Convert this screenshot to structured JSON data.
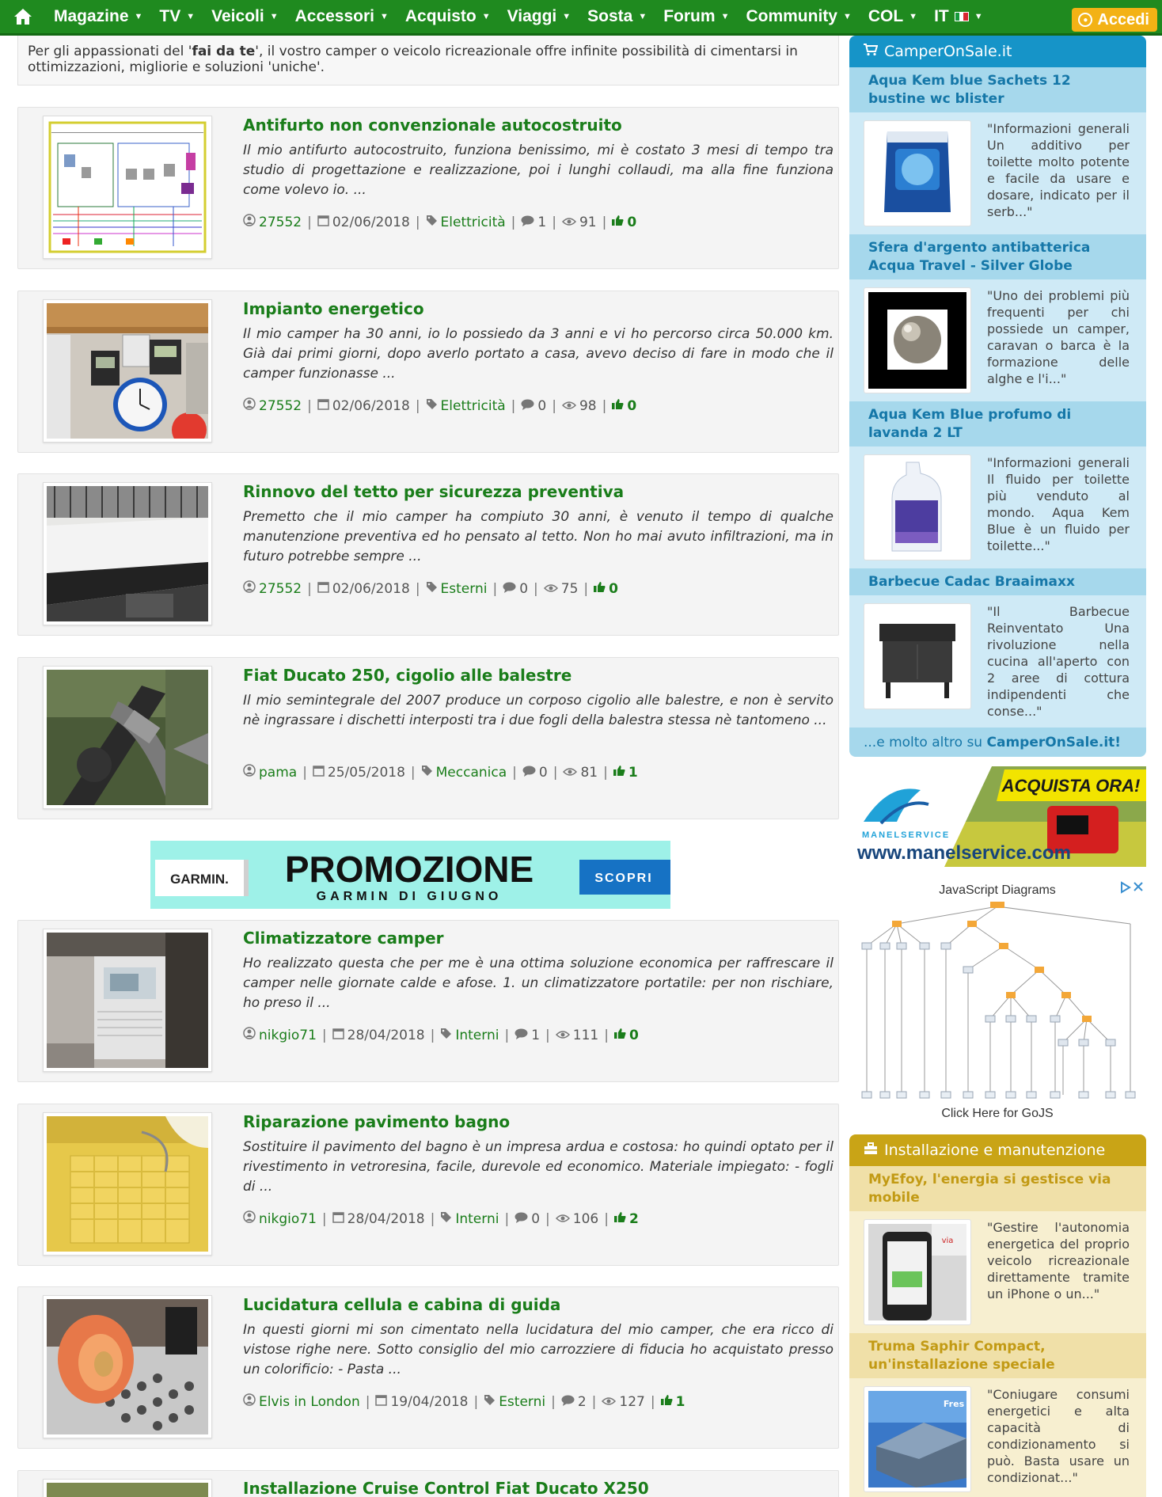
{
  "nav": {
    "items": [
      "Magazine",
      "TV",
      "Veicoli",
      "Accessori",
      "Acquisto",
      "Viaggi",
      "Sosta",
      "Forum",
      "Community",
      "COL",
      "IT"
    ],
    "login": "Accedi"
  },
  "intro": {
    "before": "Per gli appassionati del '",
    "bold": "fai da te",
    "after": "', il vostro camper o veicolo ricreazionale offre infinite possibilità di cimentarsi in ottimizzazioni, migliorie e soluzioni 'uniche'."
  },
  "articles": [
    {
      "title": "Antifurto non convenzionale autocostruito",
      "excerpt": "Il mio antifurto autocostruito, funziona benissimo, mi è costato 3 mesi di tempo tra studio di progettazione e realizzazione, poi i lunghi collaudi, ma alla fine funziona come volevo io. ...",
      "author": "27552",
      "date": "02/06/2018",
      "category": "Elettricità",
      "comments": "1",
      "views": "91",
      "likes": "0"
    },
    {
      "title": "Impianto energetico",
      "excerpt": "Il mio camper ha 30 anni, io lo possiedo da 3 anni e vi ho percorso circa 50.000 km. Già dai primi giorni, dopo averlo portato a casa, avevo deciso di fare in modo che il camper funzionasse ...",
      "author": "27552",
      "date": "02/06/2018",
      "category": "Elettricità",
      "comments": "0",
      "views": "98",
      "likes": "0"
    },
    {
      "title": "Rinnovo del tetto per sicurezza preventiva",
      "excerpt": "Premetto che il mio camper ha compiuto 30 anni, è venuto il tempo di qualche manutenzione preventiva ed ho pensato al tetto. Non ho mai avuto infiltrazioni, ma in futuro potrebbe sempre ...",
      "author": "27552",
      "date": "02/06/2018",
      "category": "Esterni",
      "comments": "0",
      "views": "75",
      "likes": "0"
    },
    {
      "title": "Fiat Ducato 250, cigolio alle balestre",
      "excerpt": "Il mio semintegrale del 2007 produce un corposo cigolio alle balestre, e non è servito nè ingrassare i dischetti interposti tra i due fogli della balestra stessa nè tantomeno ...",
      "author": "pama",
      "date": "25/05/2018",
      "category": "Meccanica",
      "comments": "0",
      "views": "81",
      "likes": "1"
    },
    {
      "title": "Climatizzatore camper",
      "excerpt": "Ho realizzato questa che per me è una ottima soluzione economica per raffrescare il camper nelle giornate calde e afose. 1. un climatizzatore portatile: per non rischiare, ho preso il ...",
      "author": "nikgio71",
      "date": "28/04/2018",
      "category": "Interni",
      "comments": "1",
      "views": "111",
      "likes": "0"
    },
    {
      "title": "Riparazione pavimento bagno",
      "excerpt": "Sostituire il pavimento del bagno è un impresa ardua e costosa: ho quindi optato per il rivestimento in vetroresina, facile, durevole ed economico. Materiale impiegato: - fogli di ...",
      "author": "nikgio71",
      "date": "28/04/2018",
      "category": "Interni",
      "comments": "0",
      "views": "106",
      "likes": "2"
    },
    {
      "title": "Lucidatura cellula e cabina di guida",
      "excerpt": "In questi giorni mi son cimentato nella lucidatura del mio camper, che era ricco di vistose righe nere. Sotto consiglio del mio carrozziere di fiducia ho acquistato presso un colorificio: - Pasta ...",
      "author": "Elvis in London",
      "date": "19/04/2018",
      "category": "Esterni",
      "comments": "2",
      "views": "127",
      "likes": "1"
    },
    {
      "title": "Installazione Cruise Control Fiat Ducato X250",
      "excerpt": "",
      "author": "",
      "date": "",
      "category": "",
      "comments": "",
      "views": "",
      "likes": ""
    }
  ],
  "banner": {
    "brand": "GARMIN.",
    "headline": "PROMOZIONE",
    "subline": "GARMIN DI GIUGNO",
    "cta": "SCOPRI"
  },
  "shop": {
    "header": "CamperOnSale.it",
    "items": [
      {
        "title": "Aqua Kem blue Sachets 12 bustine wc blister",
        "text": "\"Informazioni generali Un additivo per toilette molto potente e facile da usare e dosare, indicato per il serb...\""
      },
      {
        "title": "Sfera d'argento antibatterica Acqua Travel - Silver Globe",
        "text": "\"Uno dei problemi più frequenti per chi possiede un camper, caravan o barca è la formazione delle alghe e l'i...\""
      },
      {
        "title": "Aqua Kem Blue profumo di lavanda 2 LT",
        "text": "\"Informazioni generali Il fluido per toilette più venduto al mondo. Aqua Kem Blue è un fluido per toilette...\""
      },
      {
        "title": "Barbecue Cadac Braaimaxx",
        "text": "\"Il Barbecue Reinventato Una rivoluzione nella cucina all'aperto con 2 aree di cottura indipendenti che conse...\""
      }
    ],
    "footer_prefix": "...e molto altro su ",
    "footer_link": "CamperOnSale.it!"
  },
  "ad_manel": {
    "cta": "ACQUISTA ORA!",
    "brand": "MANELSERVICE",
    "url": "www.manelservice.com"
  },
  "ad_gojs": {
    "title": "JavaScript Diagrams",
    "footer": "Click  Here  for GoJS"
  },
  "install": {
    "header": "Installazione e manutenzione",
    "items": [
      {
        "title": "MyEfoy, l'energia si gestisce via mobile",
        "text": "\"Gestire l'autonomia energetica del proprio veicolo ricreazionale direttamente tramite un iPhone o un...\""
      },
      {
        "title": "Truma Saphir Compact, un'installazione speciale",
        "text": "\"Coniugare consumi energetici e alta capacità di condizionamento si può. Basta usare un condizionat...\""
      }
    ]
  },
  "colors": {
    "nav_green": "#1f8a1f",
    "link_green": "#1a7d1a",
    "login_orange": "#f3b215",
    "shop_blue": "#1694c8",
    "install_gold": "#c9a416"
  }
}
